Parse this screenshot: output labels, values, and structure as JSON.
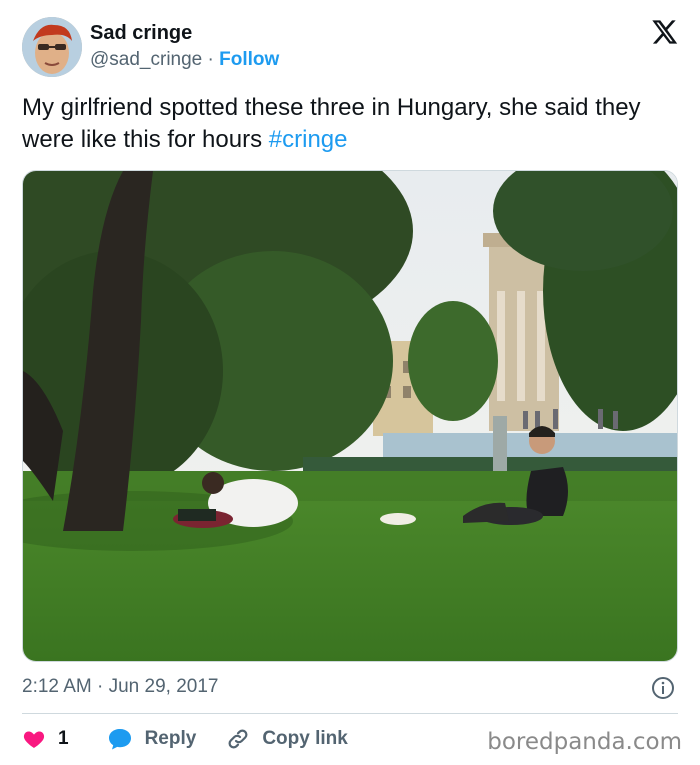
{
  "author": {
    "display_name": "Sad cringe",
    "handle": "@sad_cringe",
    "separator": "·",
    "follow_label": "Follow",
    "avatar_icon": "profile-avatar"
  },
  "brand": {
    "logo_icon": "x-logo-icon"
  },
  "tweet": {
    "text": "My girlfriend spotted these three in Hungary, she said they were like this for hours",
    "hashtag": "#cringe",
    "image_description_icon": "park-photo"
  },
  "meta": {
    "timestamp": "2:12 AM · Jun 29, 2017",
    "info_icon": "info-icon"
  },
  "actions": {
    "like_count": "1",
    "reply_label": "Reply",
    "copy_label": "Copy link"
  },
  "watermark": "boredpanda.com",
  "colors": {
    "accent": "#1d9bf0",
    "heart": "#f91880",
    "text_primary": "#0f1419",
    "text_secondary": "#536471"
  }
}
